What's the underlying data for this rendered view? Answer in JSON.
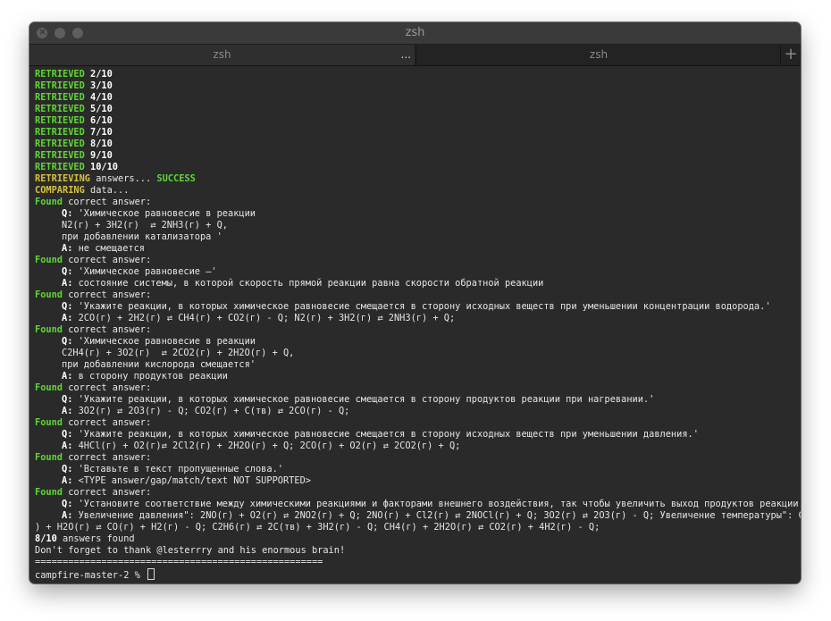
{
  "window": {
    "title": "zsh"
  },
  "tabs": [
    {
      "label": "zsh",
      "more": "..."
    },
    {
      "label": "zsh"
    }
  ],
  "new_tab": "+",
  "terminal": {
    "retrieved_label": "RETRIEVED",
    "retrieved": [
      "2/10",
      "3/10",
      "4/10",
      "5/10",
      "6/10",
      "7/10",
      "8/10",
      "9/10",
      "10/10"
    ],
    "retrieving": {
      "label": "RETRIEVING",
      "text": " answers... ",
      "status": "SUCCESS"
    },
    "comparing": {
      "label": "COMPARING",
      "text": " data..."
    },
    "found_label": "Found",
    "found_text": " correct answer:",
    "q_label": "Q:",
    "a_label": "A:",
    "answers": [
      {
        "q": [
          "'Химическое равновесие в реакции",
          "N2(г) + 3H2(г)  ⇄ 2NH3(г) + Q,",
          "при добавлении катализатора '"
        ],
        "a": [
          "не смещается"
        ]
      },
      {
        "q": [
          "'Химическое равновесие —'"
        ],
        "a": [
          "состояние системы, в которой скорость прямой реакции равна скорости обратной реакции"
        ]
      },
      {
        "q": [
          "'Укажите реакции, в которых химическое равновесие смещается в сторону исходных веществ при уменьшении концентрации водорода.'"
        ],
        "a": [
          "2CO(г) + 2H2(г) ⇄ CH4(г) + CO2(г) - Q; N2(г) + 3H2(г) ⇄ 2NH3(г) + Q;"
        ]
      },
      {
        "q": [
          "'Химическое равновесие в реакции",
          "C2H4(г) + 3O2(г)  ⇄ 2CO2(г) + 2H2O(г) + Q,",
          "при добавлении кислорода смещается'"
        ],
        "a": [
          "в сторону продуктов реакции"
        ]
      },
      {
        "q": [
          "'Укажите реакции, в которых химическое равновесие смещается в сторону продуктов реакции при нагревании.'"
        ],
        "a": [
          "3O2(г) ⇄ 2O3(г) - Q; CO2(г) + C(тв) ⇄ 2CO(г) - Q;"
        ]
      },
      {
        "q": [
          "'Укажите реакции, в которых химическое равновесие смещается в сторону исходных веществ при уменьшении давления.'"
        ],
        "a": [
          "4HCl(г) + O2(г)⇄ 2Cl2(г) + 2H2O(г) + Q; 2CO(г) + O2(г) ⇄ 2CO2(г) + Q;"
        ]
      },
      {
        "q": [
          "'Вставьте в текст пропущенные слова.'"
        ],
        "a": [
          "<TYPE answer/gap/match/text NOT SUPPORTED>"
        ]
      },
      {
        "q": [
          "'Установите соответствие между химическими реакциями и факторами внешнего воздействия, так чтобы увеличить выход продуктов реакции.'"
        ],
        "a": [
          "Увеличение давления\": 2NO(г) + O2(г) ⇄ 2NO2(г) + Q; 2NO(г) + Cl2(г) ⇄ 2NOCl(г) + Q; 3O2(г) ⇄ 2O3(г) - Q; Увеличение температуры\": C(тв"
        ],
        "a_wrap": ") + H2O(г) ⇄ CO(г) + H2(г) - Q; C2H6(г) ⇄ 2C(тв) + 3H2(г) - Q; CH4(г) + 2H2O(г) ⇄ CO2(г) + 4H2(г) - Q;"
      }
    ],
    "summary": {
      "count": "8/10",
      "text": " answers found"
    },
    "thanks": "Don't forget to thank @lesterrry and his enormous brain!",
    "separator": "====================================================",
    "prompt": "campfire-master-2 % "
  }
}
